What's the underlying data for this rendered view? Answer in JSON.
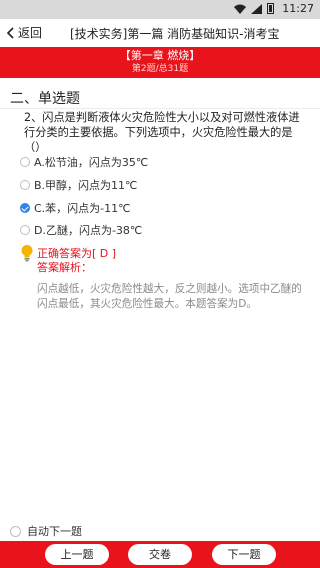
{
  "status_bar": {
    "time": "11:27"
  },
  "header": {
    "back_label": "返回",
    "title": "[技术实务]第一篇 消防基础知识-消考宝"
  },
  "chapter": {
    "name": "【第一章 燃烧】",
    "progress": "第2题/总31题"
  },
  "section": {
    "title": "二、单选题"
  },
  "question": {
    "text": "2、闪点是判断液体火灾危险性大小以及对可燃性液体进行分类的主要依据。下列选项中，火灾危险性最大的是（）",
    "options": [
      {
        "label": "A.松节油，闪点为35℃",
        "selected": false
      },
      {
        "label": "B.甲醇，闪点为11℃",
        "selected": false
      },
      {
        "label": "C.苯，闪点为-11℃",
        "selected": true
      },
      {
        "label": "D.乙醚，闪点为-38℃",
        "selected": false
      }
    ]
  },
  "answer": {
    "correct": "正确答案为[ D ]",
    "analysis_label": "答案解析：",
    "analysis_text": "闪点越低，火灾危险性越大，反之则越小。选项中乙醚的闪点最低，其火灾危险性最大。本题答案为D。"
  },
  "footer": {
    "auto_next_label": "自动下一题",
    "prev_label": "上一题",
    "submit_label": "交卷",
    "next_label": "下一题"
  },
  "colors": {
    "accent": "#e8131b",
    "selected": "#2f86e6"
  }
}
